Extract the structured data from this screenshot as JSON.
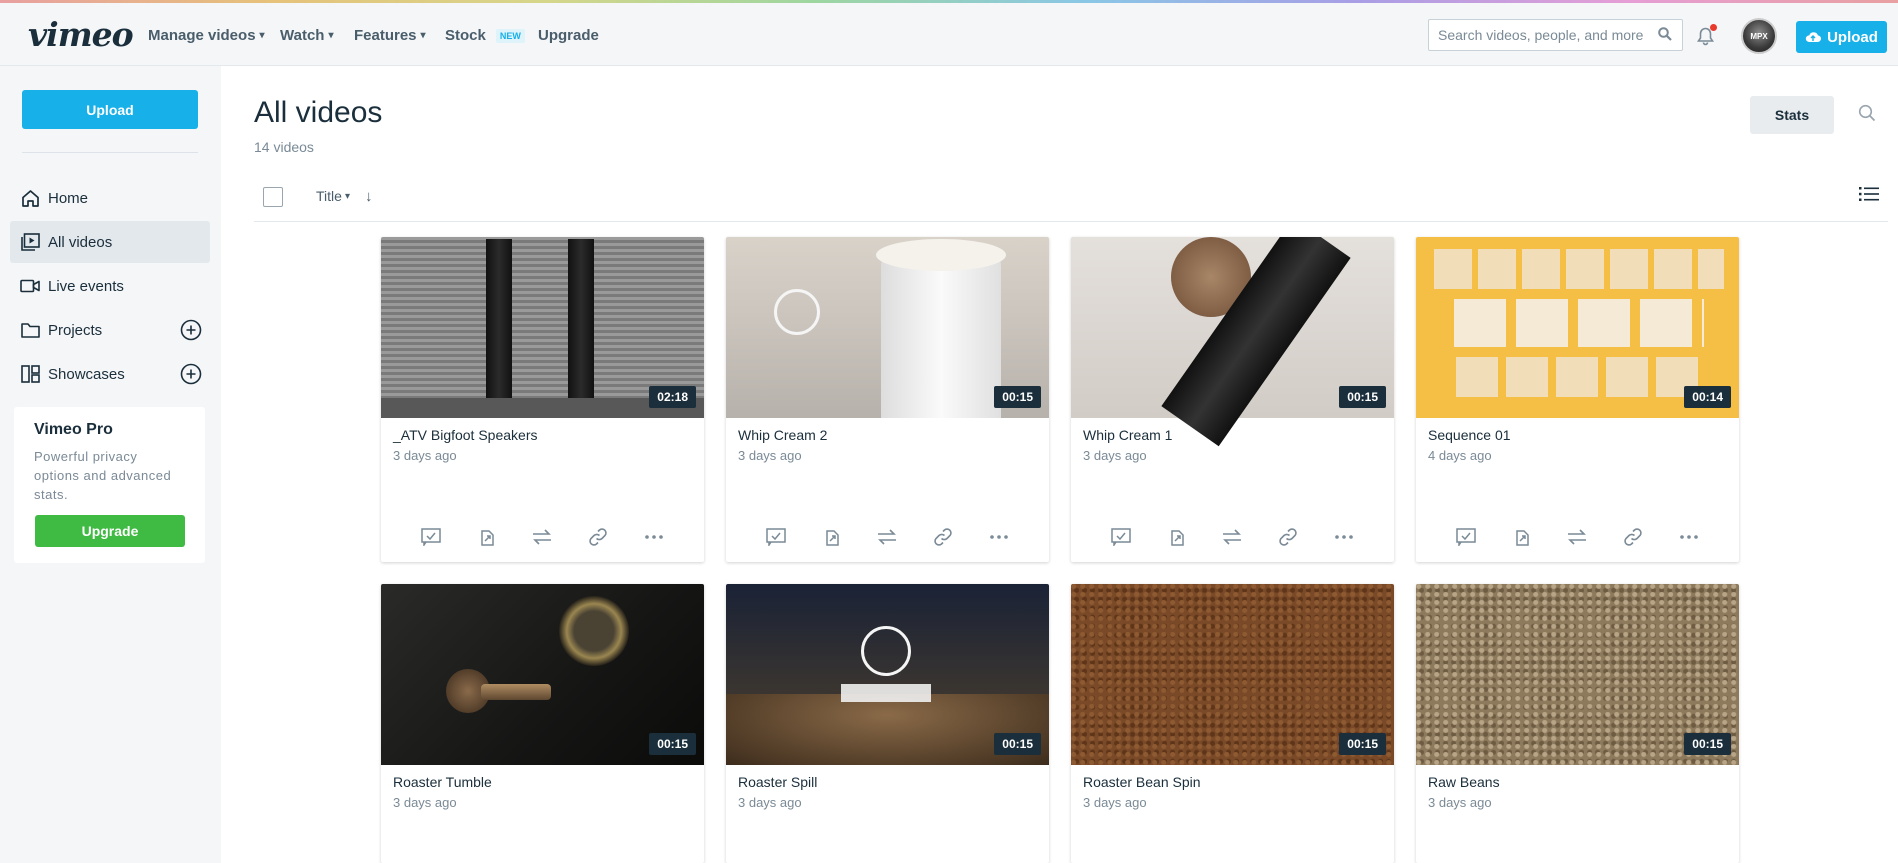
{
  "topnav": {
    "logo": "vimeo",
    "menu": [
      {
        "label": "Manage videos",
        "has_chevron": true
      },
      {
        "label": "Watch",
        "has_chevron": true
      },
      {
        "label": "Features",
        "has_chevron": true
      },
      {
        "label": "Stock",
        "badge": "NEW"
      },
      {
        "label": "Upgrade"
      }
    ],
    "search_placeholder": "Search videos, people, and more",
    "avatar_text": "MPX",
    "upload_label": "Upload",
    "colors": {
      "accent": "#17b0e8",
      "notification": "#e8392c"
    }
  },
  "sidebar": {
    "upload_label": "Upload",
    "items": [
      {
        "label": "Home",
        "icon": "home-icon",
        "active": false
      },
      {
        "label": "All videos",
        "icon": "video-library-icon",
        "active": true
      },
      {
        "label": "Live events",
        "icon": "camera-icon",
        "active": false
      },
      {
        "label": "Projects",
        "icon": "folder-icon",
        "active": false,
        "add": true
      },
      {
        "label": "Showcases",
        "icon": "showcase-icon",
        "active": false,
        "add": true
      }
    ],
    "pro": {
      "title": "Vimeo Pro",
      "text": "Powerful privacy options and advanced stats.",
      "button": "Upgrade",
      "button_color": "#3fba43"
    }
  },
  "main": {
    "title": "All videos",
    "count": "14 videos",
    "stats_label": "Stats",
    "sort_label": "Title",
    "videos": [
      {
        "title": "_ATV Bigfoot Speakers",
        "date": "3 days ago",
        "duration": "02:18"
      },
      {
        "title": "Whip Cream 2",
        "date": "3 days ago",
        "duration": "00:15"
      },
      {
        "title": "Whip Cream 1",
        "date": "3 days ago",
        "duration": "00:15"
      },
      {
        "title": "Sequence 01",
        "date": "4 days ago",
        "duration": "00:14"
      },
      {
        "title": "Roaster Tumble",
        "date": "3 days ago",
        "duration": "00:15"
      },
      {
        "title": "Roaster Spill",
        "date": "3 days ago",
        "duration": "00:15"
      },
      {
        "title": "Roaster Bean Spin",
        "date": "3 days ago",
        "duration": "00:15"
      },
      {
        "title": "Raw Beans",
        "date": "3 days ago",
        "duration": "00:15"
      }
    ],
    "card_actions": [
      "review-icon",
      "share-icon",
      "replace-icon",
      "link-icon",
      "more-icon"
    ]
  }
}
